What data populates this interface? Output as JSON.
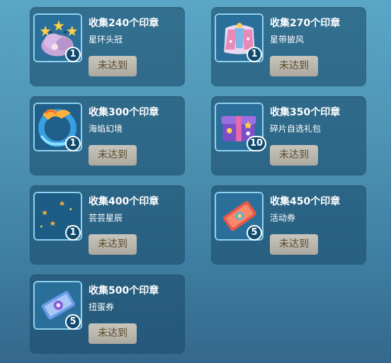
{
  "rewards": [
    {
      "title": "收集240个印章",
      "name": "星环头冠",
      "count": "1",
      "button": "未达到",
      "icon": "star-crown-icon"
    },
    {
      "title": "收集270个印章",
      "name": "星带披风",
      "count": "1",
      "button": "未达到",
      "icon": "cape-icon"
    },
    {
      "title": "收集300个印章",
      "name": "海焰幻境",
      "count": "1",
      "button": "未达到",
      "icon": "flame-ring-icon"
    },
    {
      "title": "收集350个印章",
      "name": "碎片自选礼包",
      "count": "10",
      "button": "未达到",
      "icon": "gift-box-icon"
    },
    {
      "title": "收集400个印章",
      "name": "芸芸星辰",
      "count": "1",
      "button": "未达到",
      "icon": "starry-sky-icon"
    },
    {
      "title": "收集450个印章",
      "name": "活动券",
      "count": "5",
      "button": "未达到",
      "icon": "event-ticket-icon"
    },
    {
      "title": "收集500个印章",
      "name": "扭蛋券",
      "count": "5",
      "button": "未达到",
      "icon": "gacha-ticket-icon"
    }
  ]
}
